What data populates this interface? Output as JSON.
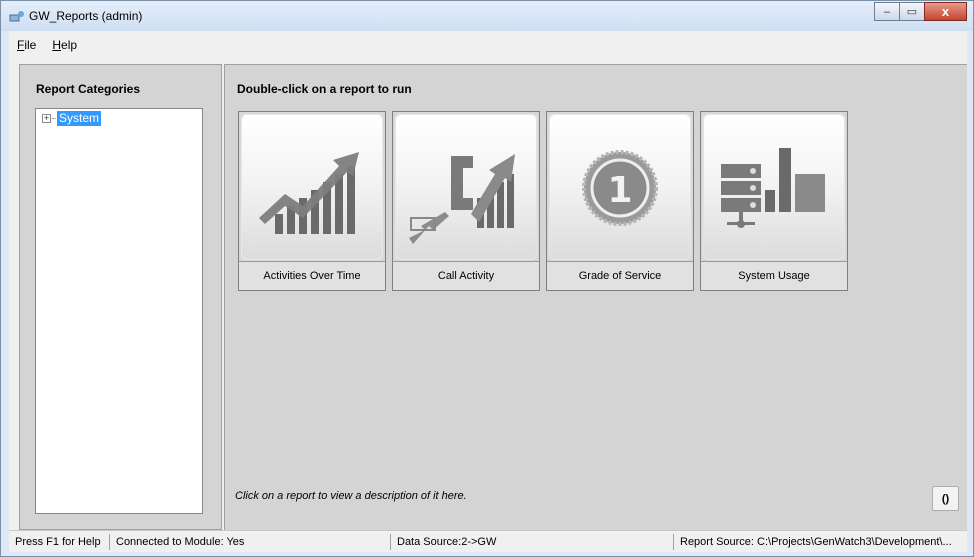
{
  "window": {
    "title": "GW_Reports (admin)",
    "controls": {
      "minimize": "–",
      "maximize": "▭",
      "close": "x"
    }
  },
  "menu": {
    "file": {
      "accel": "F",
      "rest": "ile"
    },
    "help": {
      "accel": "H",
      "rest": "elp"
    }
  },
  "left": {
    "title": "Report Categories",
    "tree": [
      {
        "label": "System",
        "expander": "+",
        "selected": true
      }
    ]
  },
  "right": {
    "title": "Double-click on a report to run",
    "reports": [
      {
        "label": "Activities Over Time",
        "icon": "chart-up-arrow-icon"
      },
      {
        "label": "Call Activity",
        "icon": "phone-chart-icon"
      },
      {
        "label": "Grade of Service",
        "icon": "medal-one-icon"
      },
      {
        "label": "System Usage",
        "icon": "server-usage-icon"
      }
    ],
    "description": "Click on a report to view a description of it here.",
    "refresh_glyph": "()"
  },
  "status": {
    "help": "Press F1 for Help",
    "connected": "Connected to Module: Yes",
    "data_source": "Data Source:2->GW",
    "report_source": "Report Source: C:\\Projects\\GenWatch3\\Development\\..."
  },
  "colors": {
    "selection": "#3399ff",
    "panel": "#d4d4d4"
  }
}
